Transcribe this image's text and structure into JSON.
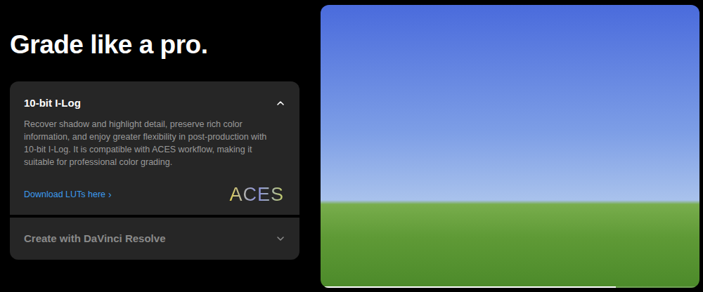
{
  "heading": "Grade like a pro.",
  "accordion": [
    {
      "title": "10-bit I-Log",
      "expanded": true,
      "body": "Recover shadow and highlight detail, preserve rich color information, and enjoy greater flexibility in post-production with 10-bit I-Log. It is compatible with ACES workflow, making it suitable for professional color grading.",
      "link": "Download LUTs here",
      "link_icon": "›",
      "logo": "ACES"
    },
    {
      "title": "Create with DaVinci Resolve",
      "expanded": false
    }
  ],
  "slideshow": {
    "level": 0.78
  }
}
